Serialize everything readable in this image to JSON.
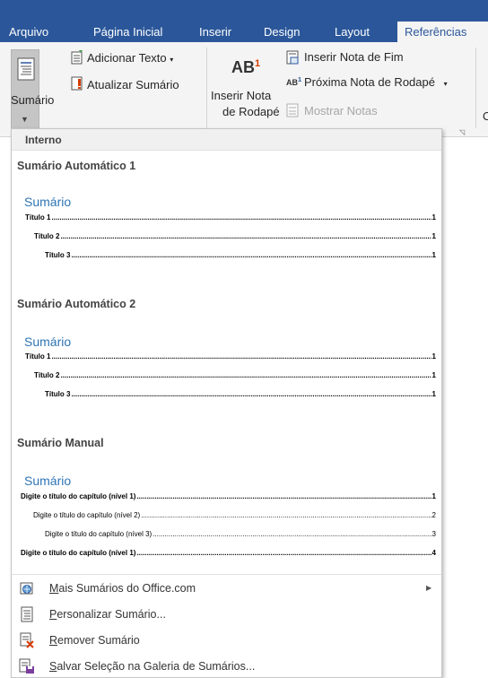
{
  "tabs": [
    {
      "label": "Arquivo"
    },
    {
      "label": "Página Inicial"
    },
    {
      "label": "Inserir"
    },
    {
      "label": "Design"
    },
    {
      "label": "Layout"
    },
    {
      "label": "Referências"
    }
  ],
  "ribbon": {
    "sumario_label": "Sumário",
    "adicionar_texto": "Adicionar Texto",
    "atualizar_sumario": "Atualizar Sumário",
    "ab_icon_text": "AB",
    "ab_superscript": "1",
    "inserir_nota_line1": "Inserir Nota",
    "inserir_nota_line2": "de Rodapé",
    "inserir_nota_fim": "Inserir Nota de Fim",
    "proxima_nota": "Próxima Nota de Rodapé",
    "mostrar_notas": "Mostrar Notas",
    "cut_letter": "C"
  },
  "panel": {
    "header": "Interno",
    "sections": [
      {
        "title": "Sumário Automático 1",
        "toc_heading": "Sumário",
        "rows": [
          {
            "text": "Título 1",
            "page": "1",
            "level": 1
          },
          {
            "text": "Título 2",
            "page": "1",
            "level": 2
          },
          {
            "text": "Título 3",
            "page": "1",
            "level": 3
          }
        ]
      },
      {
        "title": "Sumário Automático 2",
        "toc_heading": "Sumário",
        "rows": [
          {
            "text": "Título 1",
            "page": "1",
            "level": 1
          },
          {
            "text": "Título 2",
            "page": "1",
            "level": 2
          },
          {
            "text": "Título 3",
            "page": "1",
            "level": 3
          }
        ]
      },
      {
        "title": "Sumário Manual",
        "toc_heading": "Sumário",
        "rows": [
          {
            "text": "Digite o título do capítulo (nível 1)",
            "page": "1",
            "level": 1
          },
          {
            "text": "Digite o título do capítulo (nível 2)",
            "page": "2",
            "level": 2
          },
          {
            "text": "Digite o título do capítulo (nível 3)",
            "page": "3",
            "level": 3
          },
          {
            "text": "Digite o título do capítulo (nível 1)",
            "page": "4",
            "level": 1
          }
        ]
      }
    ],
    "menu": [
      {
        "label": "Mais Sumários do Office.com",
        "underline": "M",
        "rest": "ais Sumários do Office.com",
        "icon": "office-online-icon"
      },
      {
        "label": "Personalizar Sumário...",
        "underline": "P",
        "rest": "ersonalizar Sumário...",
        "icon": "custom-toc-icon"
      },
      {
        "label": "Remover Sumário",
        "underline": "R",
        "rest": "emover Sumário",
        "icon": "remove-toc-icon"
      },
      {
        "label": "Salvar Seleção na Galeria de Sumários...",
        "underline": "S",
        "rest": "alvar Seleção na Galeria de Sumários...",
        "icon": "save-gallery-icon"
      }
    ]
  },
  "colors": {
    "tab_bar": "#2b579a",
    "toc_heading": "#2e74b5",
    "ribbon_bg": "#f4f4f4"
  }
}
